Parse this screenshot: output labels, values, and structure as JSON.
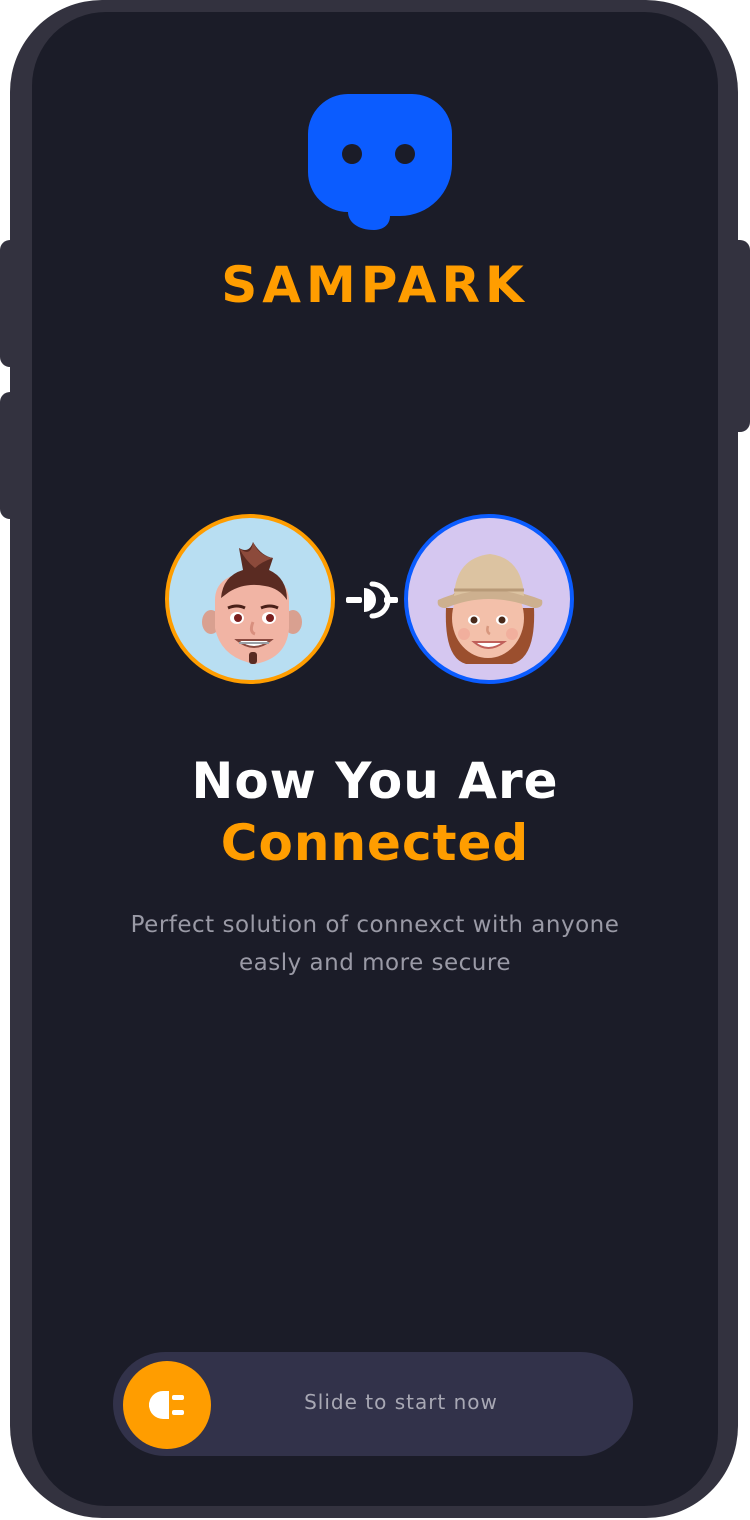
{
  "brand": {
    "name": "SAMPARK",
    "logo_icon": "chat-bubble-eyes-icon",
    "logo_color": "#0b5cff",
    "accent_color": "#ff9d00"
  },
  "connection": {
    "left_avatar": "male-memoji-avatar",
    "right_avatar": "female-memoji-avatar",
    "connector_icon": "link-connector-icon"
  },
  "headline": {
    "line1": "Now You Are",
    "line2": "Connected"
  },
  "subtitle": {
    "line1": "Perfect solution of connexct with anyone",
    "line2": "easly and more secure"
  },
  "slider": {
    "label": "Slide to start now",
    "knob_icon": "plug-icon"
  }
}
